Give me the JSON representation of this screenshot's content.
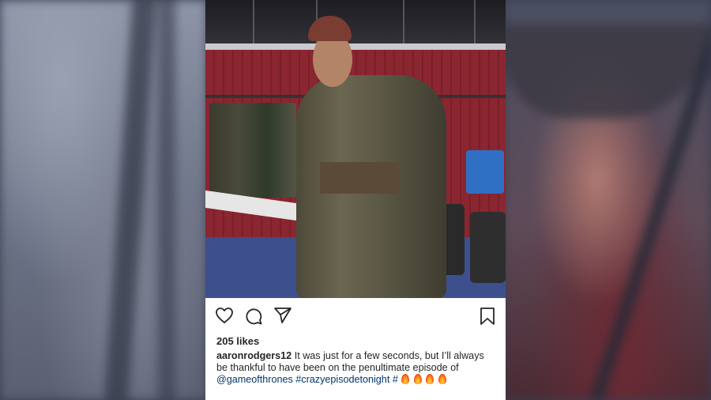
{
  "post": {
    "likes": "205 likes",
    "username": "aaronrodgers12",
    "caption_text": " It was just for a few seconds, but I’ll always be thankful to have been on the penultimate episode of ",
    "mention": "@gameofthrones",
    "hashtag": " #crazyepisodetonight #",
    "emoji": "fire-emoji"
  },
  "icons": {
    "like": "heart-icon",
    "comment": "comment-icon",
    "share": "send-icon",
    "save": "bookmark-icon"
  }
}
